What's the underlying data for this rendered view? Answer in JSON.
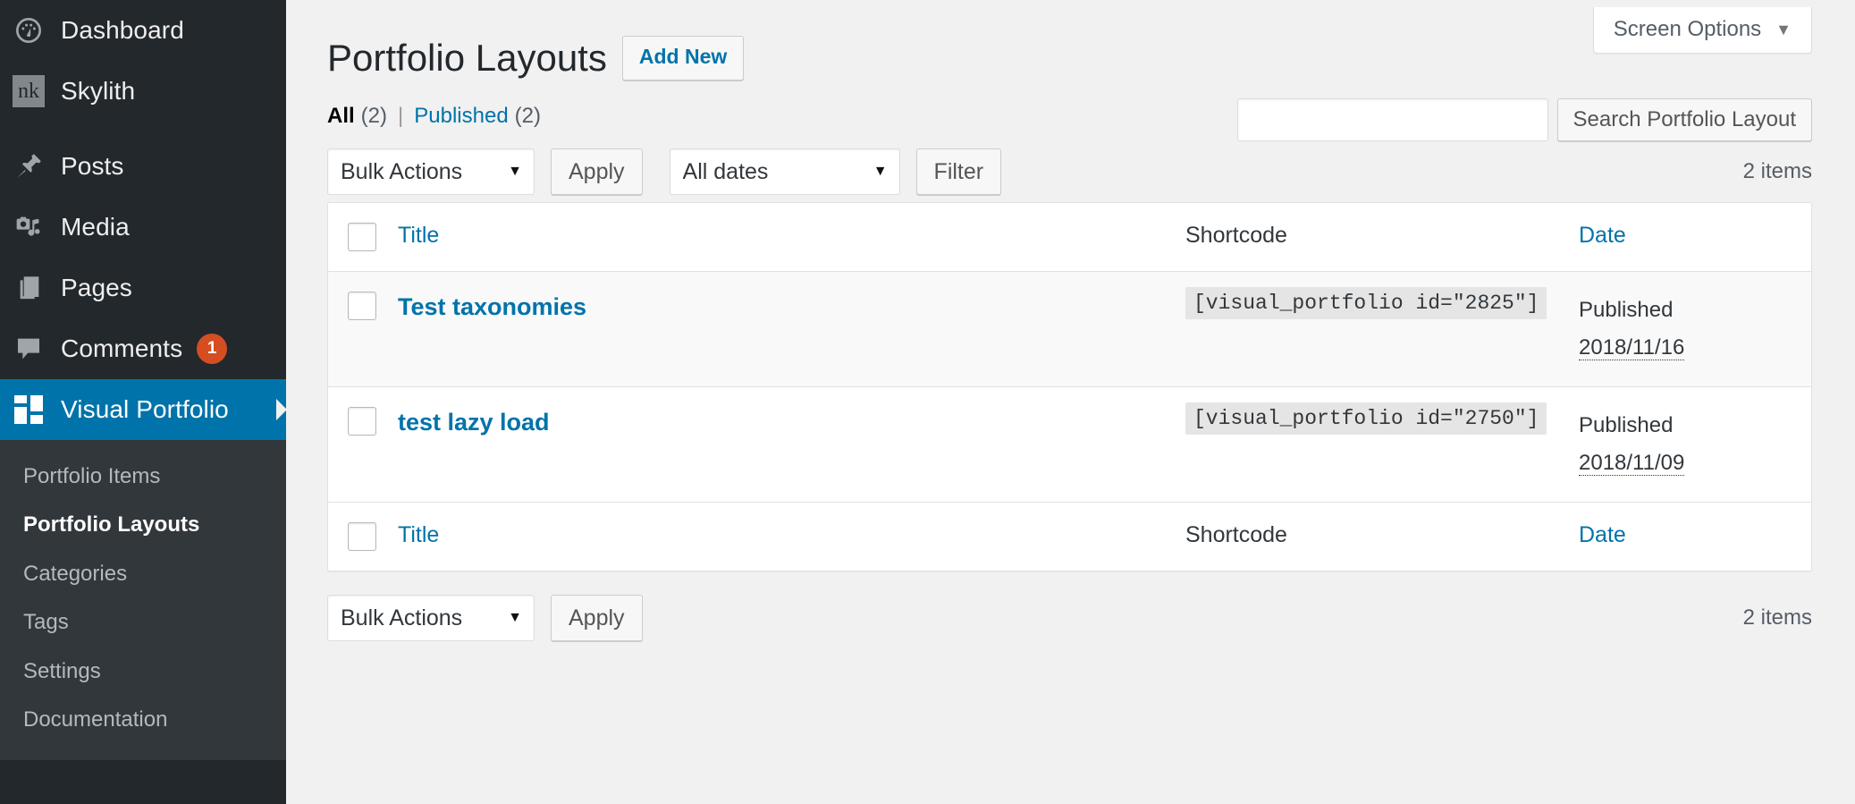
{
  "sidebar": {
    "items": [
      {
        "label": "Dashboard",
        "icon": "dashboard-icon",
        "current": false
      },
      {
        "label": "Skylith",
        "icon": "nk-logo-icon",
        "current": false
      },
      {
        "label": "Posts",
        "icon": "pin-icon",
        "current": false
      },
      {
        "label": "Media",
        "icon": "media-icon",
        "current": false
      },
      {
        "label": "Pages",
        "icon": "pages-icon",
        "current": false
      },
      {
        "label": "Comments",
        "icon": "comment-icon",
        "current": false,
        "badge": "1"
      },
      {
        "label": "Visual Portfolio",
        "icon": "grid-icon",
        "current": true
      }
    ],
    "submenu": [
      {
        "label": "Portfolio Items",
        "current": false
      },
      {
        "label": "Portfolio Layouts",
        "current": true
      },
      {
        "label": "Categories",
        "current": false
      },
      {
        "label": "Tags",
        "current": false
      },
      {
        "label": "Settings",
        "current": false
      },
      {
        "label": "Documentation",
        "current": false
      }
    ],
    "logo_text": "nk",
    "colors": {
      "background": "#23282d",
      "submenu_background": "#32373c",
      "highlight": "#0073aa",
      "badge": "#d54e21"
    }
  },
  "screen_options": {
    "label": "Screen Options",
    "caret": "▼"
  },
  "header": {
    "title": "Portfolio Layouts",
    "add_new_label": "Add New"
  },
  "status_filters": {
    "all_label": "All",
    "all_count": "(2)",
    "separator": "|",
    "published_label": "Published",
    "published_count": "(2)"
  },
  "search": {
    "value": "",
    "placeholder": "",
    "button_label": "Search Portfolio Layout"
  },
  "toolbar_top": {
    "bulk_actions_label": "Bulk Actions",
    "apply_label": "Apply",
    "dates_label": "All dates",
    "filter_label": "Filter",
    "items_count": "2 items"
  },
  "toolbar_bottom": {
    "bulk_actions_label": "Bulk Actions",
    "apply_label": "Apply",
    "items_count": "2 items"
  },
  "table": {
    "columns": {
      "title": "Title",
      "shortcode": "Shortcode",
      "date": "Date"
    },
    "rows": [
      {
        "title": "Test taxonomies",
        "shortcode": "[visual_portfolio id=\"2825\"]",
        "status": "Published",
        "date": "2018/11/16"
      },
      {
        "title": "test lazy load",
        "shortcode": "[visual_portfolio id=\"2750\"]",
        "status": "Published",
        "date": "2018/11/09"
      }
    ]
  }
}
